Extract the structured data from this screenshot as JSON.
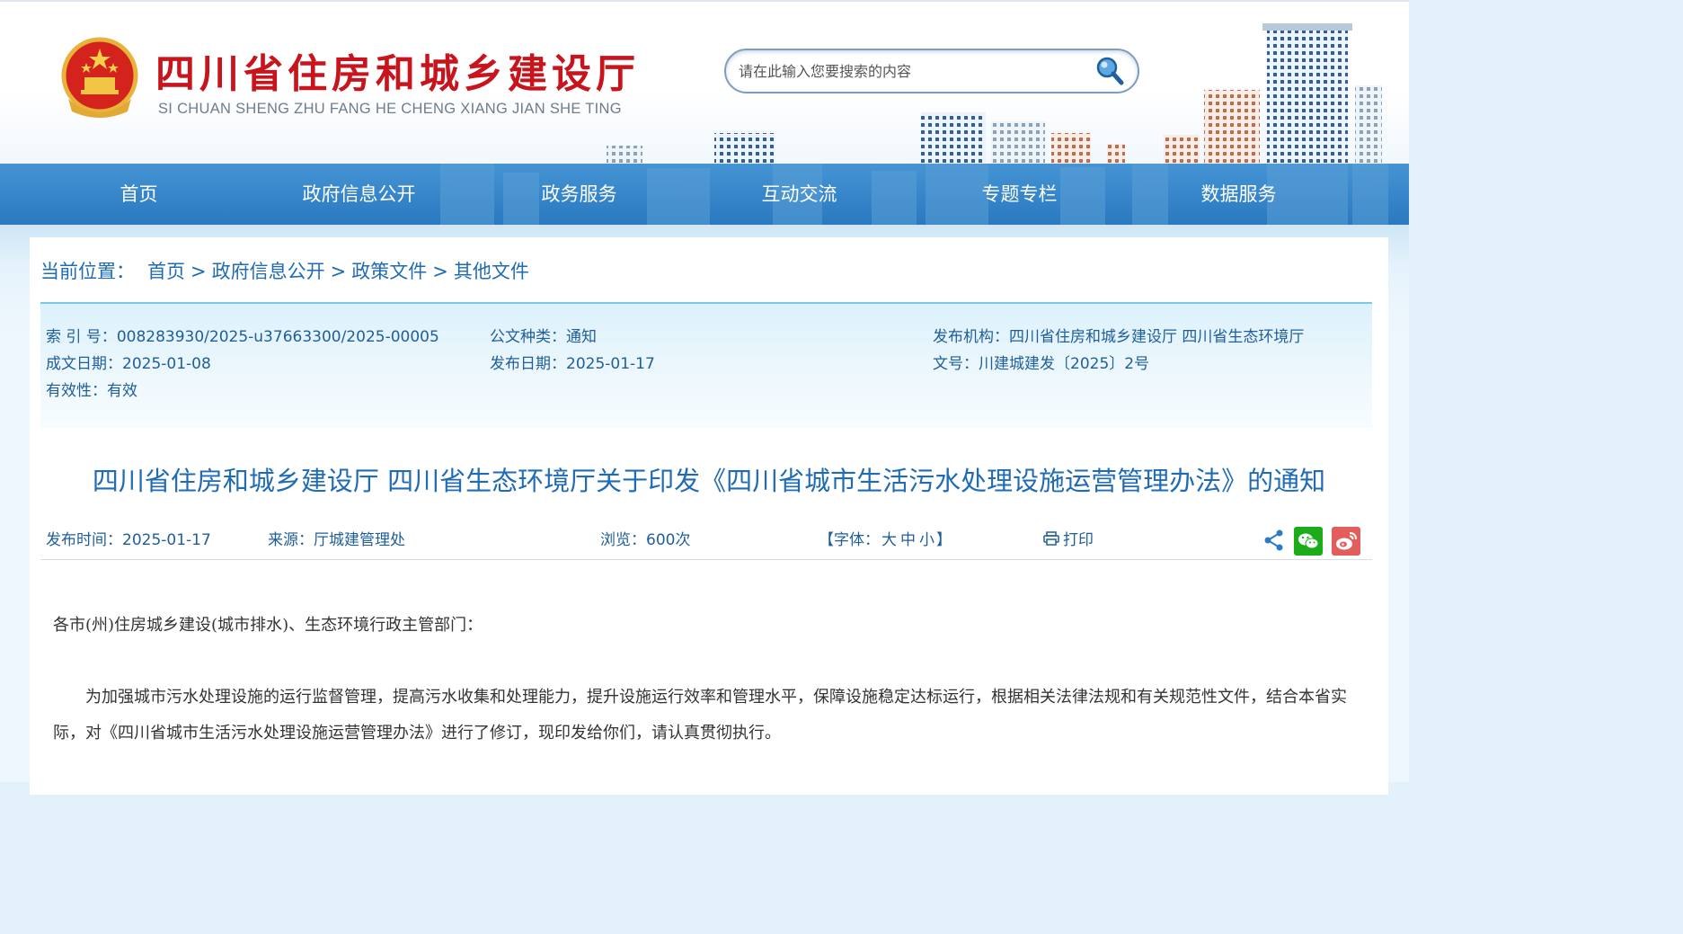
{
  "header": {
    "site_title": "四川省住房和城乡建设厅",
    "site_pinyin": "SI CHUAN SHENG ZHU FANG HE CHENG XIANG JIAN SHE TING",
    "search_placeholder": "请在此输入您要搜索的内容",
    "brand_red": "#c8151d",
    "nav_blue": "#2f82c6"
  },
  "nav": {
    "items": [
      "首页",
      "政府信息公开",
      "政务服务",
      "互动交流",
      "专题专栏",
      "数据服务"
    ]
  },
  "breadcrumb": {
    "label": "当前位置：",
    "items": [
      "首页",
      "政府信息公开",
      "政策文件",
      "其他文件"
    ],
    "separator": ">"
  },
  "meta": {
    "index_no_label": "索 引 号：",
    "index_no": "008283930/2025-u37663300/2025-00005",
    "doc_type_label": "公文种类：",
    "doc_type": "通知",
    "publisher_label": "发布机构：",
    "publisher": "四川省住房和城乡建设厅 四川省生态环境厅",
    "created_label": "成文日期：",
    "created": "2025-01-08",
    "published_label": "发布日期：",
    "published": "2025-01-17",
    "doc_no_label": "文号：",
    "doc_no": "川建城建发〔2025〕2号",
    "validity_label": "有效性：",
    "validity": "有效"
  },
  "article": {
    "title": "四川省住房和城乡建设厅 四川省生态环境厅关于印发《四川省城市生活污水处理设施运营管理办法》的通知",
    "publish_time_label": "发布时间：",
    "publish_time": "2025-01-17",
    "source_label": "来源：",
    "source": "厅城建管理处",
    "views_label": "浏览：",
    "views": "600次",
    "font_label": "【字体：",
    "font_large": "大",
    "font_medium": "中",
    "font_small": "小",
    "font_close": "】",
    "print_label": "打印",
    "salutation": "各市(州)住房城乡建设(城市排水)、生态环境行政主管部门：",
    "paragraph_1": "为加强城市污水处理设施的运行监督管理，提高污水收集和处理能力，提升设施运行效率和管理水平，保障设施稳定达标运行，根据相关法律法规和有关规范性文件，结合本省实际，对《四川省城市生活污水处理设施运营管理办法》进行了修订，现印发给你们，请认真贯彻执行。"
  },
  "icons": {
    "emblem": "national-emblem-icon",
    "search": "search-icon",
    "share": "share-icon",
    "wechat": "wechat-icon",
    "weibo": "weibo-icon",
    "print": "printer-icon"
  }
}
